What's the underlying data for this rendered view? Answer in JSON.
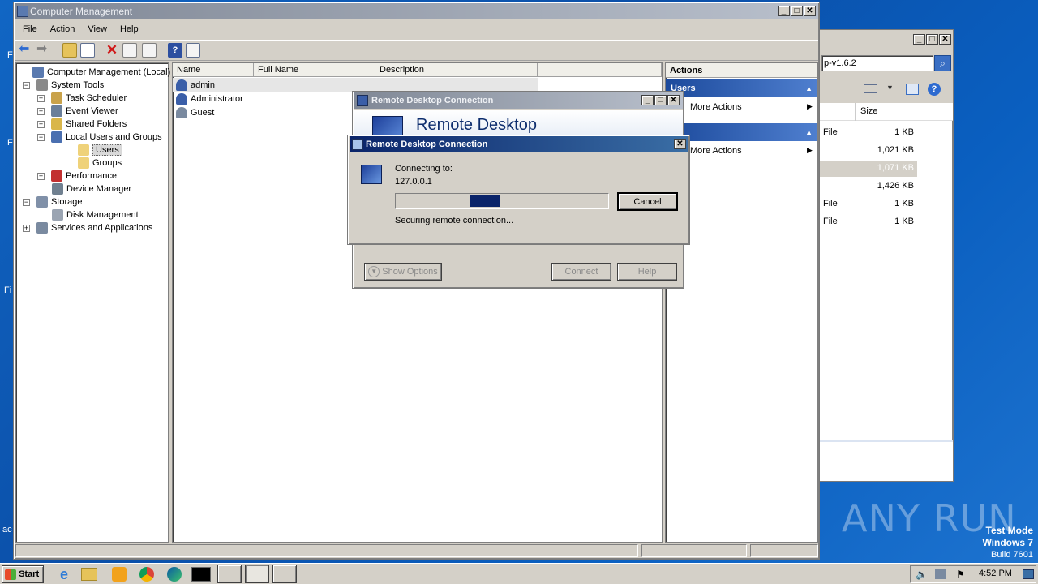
{
  "computer_management": {
    "title": "Computer Management",
    "menu": [
      "File",
      "Action",
      "View",
      "Help"
    ],
    "tree": [
      {
        "label": "Computer Management (Local)",
        "icon": "computer-icon"
      },
      {
        "label": "System Tools",
        "icon": "tools-icon"
      },
      {
        "label": "Task Scheduler",
        "icon": "clock-icon"
      },
      {
        "label": "Event Viewer",
        "icon": "event-viewer-icon"
      },
      {
        "label": "Shared Folders",
        "icon": "shared-folder-icon"
      },
      {
        "label": "Local Users and Groups",
        "icon": "users-icon"
      },
      {
        "label": "Users",
        "icon": "folder-icon"
      },
      {
        "label": "Groups",
        "icon": "folder-icon"
      },
      {
        "label": "Performance",
        "icon": "performance-icon"
      },
      {
        "label": "Device Manager",
        "icon": "device-manager-icon"
      },
      {
        "label": "Storage",
        "icon": "storage-icon"
      },
      {
        "label": "Disk Management",
        "icon": "disk-icon"
      },
      {
        "label": "Services and Applications",
        "icon": "services-icon"
      }
    ],
    "columns": [
      "Name",
      "Full Name",
      "Description"
    ],
    "users": [
      "admin",
      "Administrator",
      "Guest"
    ],
    "actions": {
      "header": "Actions",
      "section1": "Users",
      "section2": "pin",
      "more_actions": "More Actions"
    }
  },
  "explorer_partial": {
    "search_value": "p-v1.6.2",
    "size_header": "Size",
    "rows": [
      {
        "type": "File",
        "size": "1 KB"
      },
      {
        "type": "",
        "size": "1,021 KB"
      },
      {
        "type": "",
        "size": "1,071 KB"
      },
      {
        "type": "",
        "size": "1,426 KB"
      },
      {
        "type": "File",
        "size": "1 KB"
      },
      {
        "type": "File",
        "size": "1 KB"
      }
    ]
  },
  "rdc_back": {
    "title": "Remote Desktop Connection",
    "banner": "Remote Desktop",
    "show_options": "Show Options",
    "connect": "Connect",
    "help": "Help"
  },
  "rdc_front": {
    "title": "Remote Desktop Connection",
    "connecting_to": "Connecting to:",
    "host": "127.0.0.1",
    "status": "Securing remote connection...",
    "cancel": "Cancel",
    "progress": 0.27
  },
  "watermark": {
    "brand": "ANY RUN",
    "test_mode": "Test Mode",
    "os": "Windows 7",
    "build": "Build 7601"
  },
  "taskbar": {
    "start": "Start",
    "time": "4:52 PM"
  },
  "colors": {
    "desktop": "#1166c4",
    "title_active": "#0a246a",
    "action_band": "#1c4a9c",
    "progress_fill": "#0a246a"
  }
}
